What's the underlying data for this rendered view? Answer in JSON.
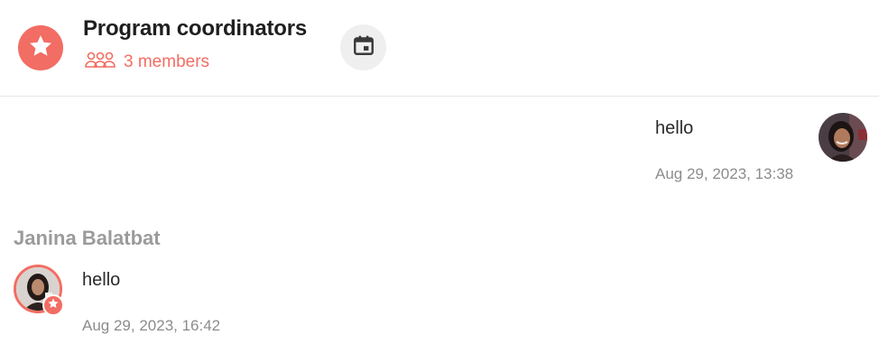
{
  "colors": {
    "accent": "#f26d63",
    "icon_bg": "#efefef",
    "timestamp": "#8c8c8c",
    "sender_name": "#9b9b9b"
  },
  "header": {
    "group_icon": "star-icon",
    "title": "Program coordinators",
    "members_icon": "people-icon",
    "members_label": "3 members",
    "calendar_icon": "calendar-icon"
  },
  "messages": [
    {
      "side": "right",
      "text": "hello",
      "time": "Aug 29, 2023, 13:38",
      "avatar": "user-avatar"
    },
    {
      "side": "left",
      "sender": "Janina Balatbat",
      "text": "hello",
      "time": "Aug 29, 2023, 16:42",
      "avatar": "sender-avatar",
      "badge_icon": "star-icon"
    }
  ]
}
